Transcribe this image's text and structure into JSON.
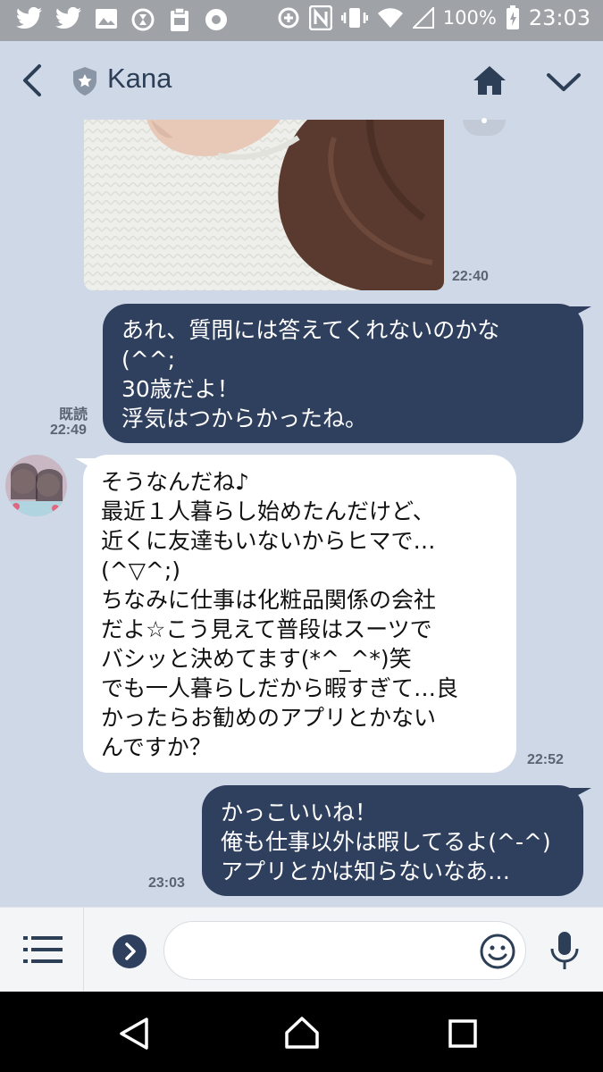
{
  "status_bar": {
    "battery": "100%",
    "time": "23:03",
    "icons": [
      "twitter-icon",
      "twitter-icon",
      "image-icon",
      "hourglass-icon",
      "clipboard-icon",
      "settings-icon",
      "data-saver-icon",
      "nfc-icon",
      "vibrate-icon",
      "wifi-icon",
      "signal-icon",
      "battery-icon"
    ]
  },
  "header": {
    "title": "Kana",
    "icons": [
      "back-icon",
      "shield-icon",
      "home-icon",
      "chevron-down-icon"
    ]
  },
  "messages": [
    {
      "type": "incoming-image",
      "time": "22:40"
    },
    {
      "type": "outgoing",
      "read": "既読",
      "time": "22:49",
      "text": "あれ、質問には答えてくれないのかな\n(^^;\n30歳だよ！\n浮気はつからかったね。"
    },
    {
      "type": "incoming",
      "time": "22:52",
      "text": "そうなんだね♪\n最近１人暮らし始めたんだけど、\n近くに友達もいないからヒマで…\n(^▽^;)\nちなみに仕事は化粧品関係の会社\nだよ☆こう見えて普段はスーツで\nバシッと決めてます(*^_^*)笑\nでも一人暮らしだから暇すぎて…良\nかったらお勧めのアプリとかない\nんですか？"
    },
    {
      "type": "outgoing",
      "time": "23:03",
      "text": "かっこいいね！\n俺も仕事以外は暇してるよ(^-^)\nアプリとかは知らないなあ…"
    }
  ],
  "input_bar": {
    "placeholder": ""
  },
  "colors": {
    "background": "#cfd8e6",
    "outgoing_bubble": "#2f3f5e",
    "incoming_bubble": "#ffffff",
    "header_text": "#2d3f57"
  }
}
